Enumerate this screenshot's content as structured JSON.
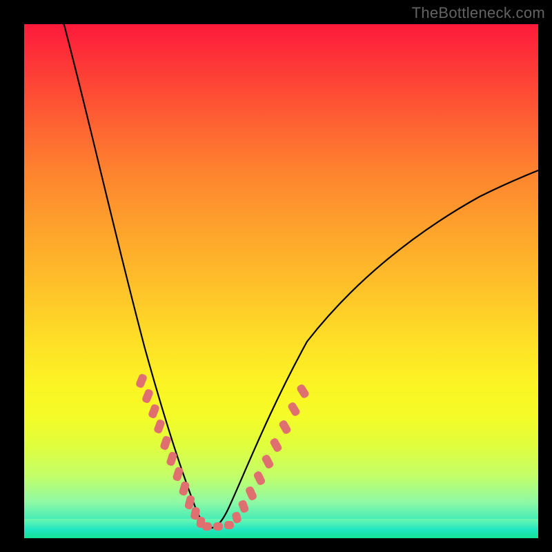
{
  "watermark": "TheBottleneck.com",
  "colors": {
    "background": "#000000",
    "curve_stroke": "#000000",
    "dot_fill": "#e07070",
    "gradient_top": "#fd1a3b",
    "gradient_bottom": "#12e393"
  },
  "chart_data": {
    "type": "line",
    "title": "",
    "xlabel": "",
    "ylabel": "",
    "xlim": [
      0,
      100
    ],
    "ylim": [
      0,
      100
    ],
    "grid": false,
    "annotations": [
      "TheBottleneck.com"
    ],
    "series": [
      {
        "name": "bottleneck-curve",
        "x": [
          2,
          6,
          10,
          14,
          18,
          22,
          25,
          27,
          29,
          31,
          33,
          34,
          35,
          36,
          37,
          39,
          41,
          44,
          48,
          55,
          65,
          78,
          92,
          100
        ],
        "y": [
          100,
          82,
          66,
          52,
          40,
          30,
          22,
          16,
          11,
          7,
          4,
          2,
          1,
          1,
          2,
          4,
          8,
          14,
          22,
          33,
          44,
          55,
          65,
          70
        ]
      }
    ],
    "markers": [
      {
        "name": "highlighted-points-left",
        "x": [
          22.5,
          24,
          25,
          26,
          27.5,
          29,
          30,
          31,
          32,
          33,
          34
        ],
        "y": [
          28,
          25,
          22,
          19,
          15.5,
          12,
          9.5,
          7,
          5,
          3,
          2
        ]
      },
      {
        "name": "highlighted-points-bottom",
        "x": [
          34.5,
          35.5,
          36.5,
          37.5
        ],
        "y": [
          1,
          1,
          1,
          1.5
        ]
      },
      {
        "name": "highlighted-points-right",
        "x": [
          38.5,
          40,
          41.5,
          43,
          44.5,
          46,
          48,
          50
        ],
        "y": [
          3.5,
          6,
          9,
          12,
          15.5,
          19,
          23,
          27
        ]
      }
    ]
  }
}
